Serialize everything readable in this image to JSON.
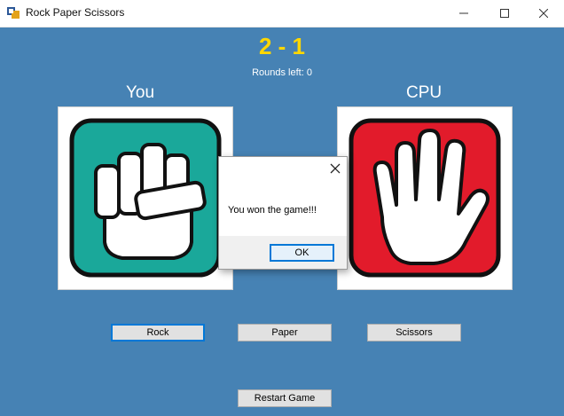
{
  "window": {
    "title": "Rock Paper Scissors",
    "icons": [
      "app-icon",
      "minimize-icon",
      "maximize-icon",
      "close-icon"
    ]
  },
  "game": {
    "score": "2 - 1",
    "rounds_left": "Rounds left: 0",
    "player_label": "You",
    "cpu_label": "CPU",
    "player_choice": "rock",
    "cpu_choice": "paper"
  },
  "colors": {
    "background": "#4682b4",
    "score": "#ffd700",
    "player_tile": "#1aa89a",
    "cpu_tile": "#e21b2b"
  },
  "buttons": {
    "rock": "Rock",
    "paper": "Paper",
    "scissors": "Scissors",
    "restart": "Restart Game"
  },
  "dialog": {
    "message": "You won the game!!!",
    "ok": "OK"
  }
}
